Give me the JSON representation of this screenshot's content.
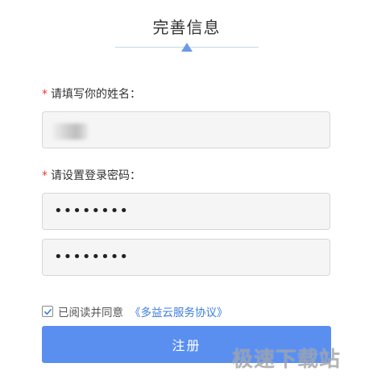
{
  "header": {
    "title": "完善信息"
  },
  "form": {
    "name_label": "请填写你的姓名：",
    "name_required_mark": "*",
    "password_label": "请设置登录密码：",
    "password_required_mark": "*",
    "password_value": "••••••••",
    "confirm_password_value": "••••••••",
    "agree_checked": true,
    "agree_text": "已阅读并同意",
    "agreement_link": "《多益云服务协议》",
    "submit_label": "注册"
  },
  "watermark": {
    "text": "极速下载站"
  },
  "colors": {
    "accent": "#5a8ff0",
    "link": "#3b7ddd",
    "required": "#e53935"
  }
}
